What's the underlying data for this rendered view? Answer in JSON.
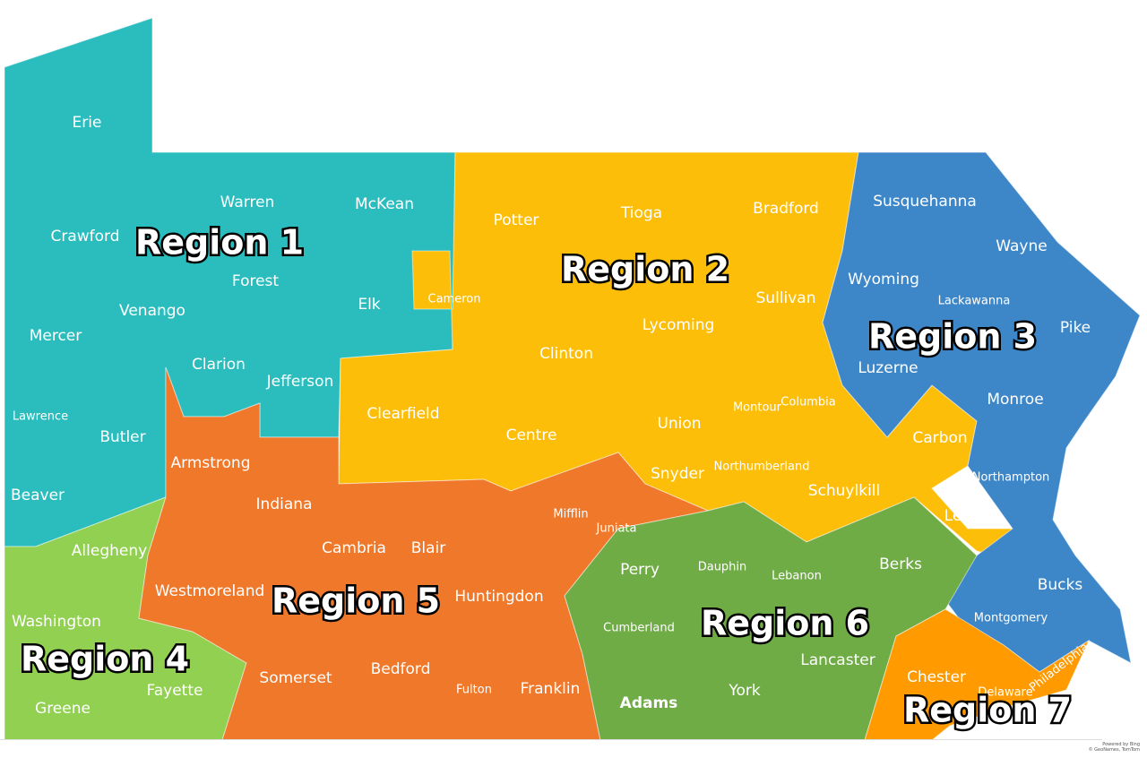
{
  "regions": [
    {
      "label": "Region 1",
      "color": "#2bbdbe",
      "counties": [
        "Erie",
        "Warren",
        "McKean",
        "Crawford",
        "Forest",
        "Elk",
        "Mercer",
        "Venango",
        "Clarion",
        "Jefferson",
        "Lawrence",
        "Butler",
        "Beaver"
      ]
    },
    {
      "label": "Region 2",
      "color": "#fdbe0a",
      "counties": [
        "Potter",
        "Tioga",
        "Bradford",
        "Cameron",
        "Sullivan",
        "Lycoming",
        "Clinton",
        "Clearfield",
        "Centre",
        "Union",
        "Montour",
        "Columbia",
        "Snyder",
        "Northumberland",
        "Schuylkill",
        "Carbon",
        "Lehigh"
      ]
    },
    {
      "label": "Region 3",
      "color": "#3d87c9",
      "counties": [
        "Susquehanna",
        "Wayne",
        "Wyoming",
        "Lackawanna",
        "Pike",
        "Luzerne",
        "Monroe",
        "Northampton",
        "Bucks",
        "Montgomery"
      ]
    },
    {
      "label": "Region 4",
      "color": "#91d050",
      "counties": [
        "Allegheny",
        "Washington",
        "Greene",
        "Fayette"
      ]
    },
    {
      "label": "Region 5",
      "color": "#f0782a",
      "counties": [
        "Armstrong",
        "Indiana",
        "Westmoreland",
        "Cambria",
        "Blair",
        "Mifflin",
        "Juniata",
        "Huntingdon",
        "Somerset",
        "Bedford",
        "Fulton",
        "Franklin"
      ]
    },
    {
      "label": "Region 6",
      "color": "#6fac45",
      "counties": [
        "Perry",
        "Dauphin",
        "Lebanon",
        "Berks",
        "Cumberland",
        "Lancaster",
        "Adams",
        "York"
      ]
    },
    {
      "label": "Region 7",
      "color": "#ff9b00",
      "counties": [
        "Chester",
        "Delaware",
        "Philadelphia"
      ]
    }
  ],
  "attribution": [
    "Powered by Bing",
    "© GeoNames, TomTom"
  ]
}
